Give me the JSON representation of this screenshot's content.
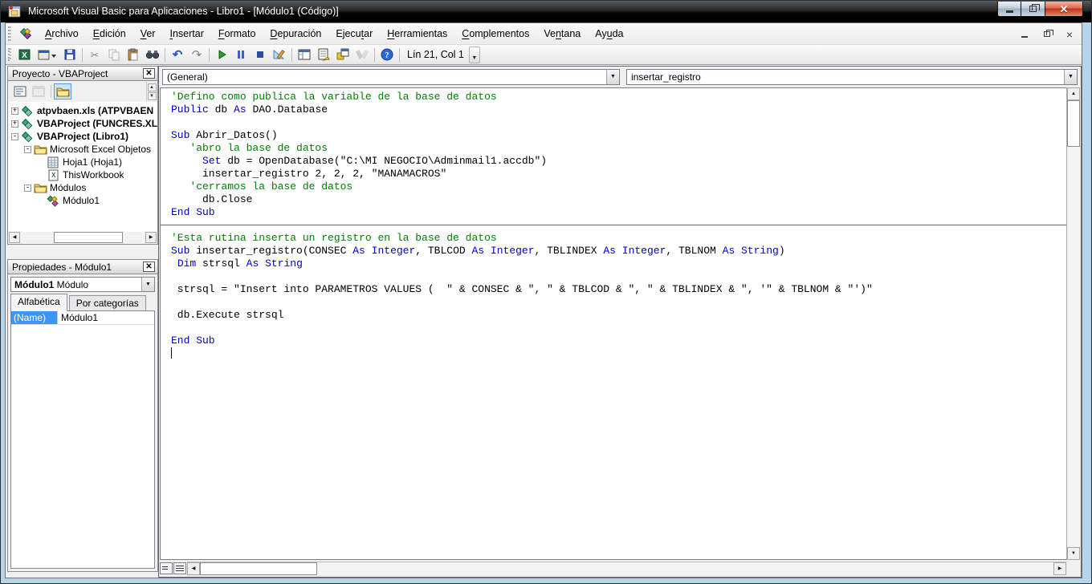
{
  "window": {
    "title": "Microsoft Visual Basic para Aplicaciones - Libro1 - [Módulo1 (Código)]"
  },
  "menu": {
    "items": [
      {
        "label": "Archivo",
        "u": 0
      },
      {
        "label": "Edición",
        "u": 0
      },
      {
        "label": "Ver",
        "u": 0
      },
      {
        "label": "Insertar",
        "u": 0
      },
      {
        "label": "Formato",
        "u": 0
      },
      {
        "label": "Depuración",
        "u": 0
      },
      {
        "label": "Ejecutar",
        "u": 5
      },
      {
        "label": "Herramientas",
        "u": 0
      },
      {
        "label": "Complementos",
        "u": 0
      },
      {
        "label": "Ventana",
        "u": 2
      },
      {
        "label": "Ayuda",
        "u": 2
      }
    ]
  },
  "toolbar": {
    "position_text": "Lín 21, Col 1",
    "icons": [
      "view-excel",
      "insert-userform",
      "save",
      "cut",
      "copy",
      "paste",
      "find",
      "undo",
      "redo",
      "run",
      "break",
      "reset",
      "design-mode",
      "project-explorer",
      "properties-window",
      "object-browser",
      "toolbox",
      "help"
    ]
  },
  "project_panel": {
    "title": "Proyecto - VBAProject",
    "toolbar_icons": [
      "view-code",
      "view-object",
      "toggle-folders"
    ],
    "tree": [
      {
        "level": 0,
        "expand": "+",
        "icon": "project",
        "label": "atpvbaen.xls (ATPVBAEN",
        "bold": true
      },
      {
        "level": 0,
        "expand": "+",
        "icon": "project",
        "label": "VBAProject (FUNCRES.XL",
        "bold": true
      },
      {
        "level": 0,
        "expand": "-",
        "icon": "project",
        "label": "VBAProject (Libro1)",
        "bold": true
      },
      {
        "level": 1,
        "expand": "-",
        "icon": "folder",
        "label": "Microsoft Excel Objetos",
        "bold": false
      },
      {
        "level": 2,
        "expand": "",
        "icon": "worksheet",
        "label": "Hoja1 (Hoja1)",
        "bold": false
      },
      {
        "level": 2,
        "expand": "",
        "icon": "workbook",
        "label": "ThisWorkbook",
        "bold": false
      },
      {
        "level": 1,
        "expand": "-",
        "icon": "folder",
        "label": "Módulos",
        "bold": false
      },
      {
        "level": 2,
        "expand": "",
        "icon": "module",
        "label": "Módulo1",
        "bold": false
      }
    ]
  },
  "properties_panel": {
    "title": "Propiedades - Módulo1",
    "selected_object": "Módulo1",
    "selected_object_type": "Módulo",
    "tabs": [
      {
        "label": "Alfabética",
        "active": true
      },
      {
        "label": "Por categorías",
        "active": false
      }
    ],
    "rows": [
      {
        "name": "(Name)",
        "value": "Módulo1"
      }
    ]
  },
  "code_window": {
    "object_dropdown": "(General)",
    "procedure_dropdown": "insertar_registro",
    "colors": {
      "keyword": "#0000c8",
      "comment": "#008000",
      "text": "#000000"
    },
    "separator_line": 11,
    "caret_line": 21,
    "lines": [
      [
        {
          "c": "cm",
          "s": "'Defino como publica la variable de la base de datos"
        }
      ],
      [
        {
          "c": "kw",
          "s": "Public"
        },
        {
          "c": "tx",
          "s": " db "
        },
        {
          "c": "kw",
          "s": "As"
        },
        {
          "c": "tx",
          "s": " DAO.Database"
        }
      ],
      [],
      [
        {
          "c": "kw",
          "s": "Sub"
        },
        {
          "c": "tx",
          "s": " Abrir_Datos()"
        }
      ],
      [
        {
          "c": "cm",
          "s": "   'abro la base de datos"
        }
      ],
      [
        {
          "c": "tx",
          "s": "     "
        },
        {
          "c": "kw",
          "s": "Set"
        },
        {
          "c": "tx",
          "s": " db = OpenDatabase(\"C:\\MI NEGOCIO\\Adminmail1.accdb\")"
        }
      ],
      [
        {
          "c": "tx",
          "s": "     insertar_registro 2, 2, 2, \"MANAMACROS\""
        }
      ],
      [
        {
          "c": "cm",
          "s": "   'cerramos la base de datos"
        }
      ],
      [
        {
          "c": "tx",
          "s": "     db.Close"
        }
      ],
      [
        {
          "c": "kw",
          "s": "End Sub"
        }
      ],
      [],
      [
        {
          "c": "cm",
          "s": "'Esta rutina inserta un registro en la base de datos"
        }
      ],
      [
        {
          "c": "kw",
          "s": "Sub"
        },
        {
          "c": "tx",
          "s": " insertar_registro(CONSEC "
        },
        {
          "c": "kw",
          "s": "As"
        },
        {
          "c": "tx",
          "s": " "
        },
        {
          "c": "kw",
          "s": "Integer"
        },
        {
          "c": "tx",
          "s": ", TBLCOD "
        },
        {
          "c": "kw",
          "s": "As"
        },
        {
          "c": "tx",
          "s": " "
        },
        {
          "c": "kw",
          "s": "Integer"
        },
        {
          "c": "tx",
          "s": ", TBLINDEX "
        },
        {
          "c": "kw",
          "s": "As"
        },
        {
          "c": "tx",
          "s": " "
        },
        {
          "c": "kw",
          "s": "Integer"
        },
        {
          "c": "tx",
          "s": ", TBLNOM "
        },
        {
          "c": "kw",
          "s": "As"
        },
        {
          "c": "tx",
          "s": " "
        },
        {
          "c": "kw",
          "s": "String"
        },
        {
          "c": "tx",
          "s": ")"
        }
      ],
      [
        {
          "c": "tx",
          "s": " "
        },
        {
          "c": "kw",
          "s": "Dim"
        },
        {
          "c": "tx",
          "s": " strsql "
        },
        {
          "c": "kw",
          "s": "As"
        },
        {
          "c": "tx",
          "s": " "
        },
        {
          "c": "kw",
          "s": "String"
        }
      ],
      [],
      [
        {
          "c": "tx",
          "s": " strsql = \"Insert into PARAMETROS VALUES (  \" & CONSEC & \", \" & TBLCOD & \", \" & TBLINDEX & \", '\" & TBLNOM & \"')\""
        }
      ],
      [],
      [
        {
          "c": "tx",
          "s": " db.Execute strsql"
        }
      ],
      [],
      [
        {
          "c": "kw",
          "s": "End Sub"
        }
      ],
      []
    ]
  }
}
